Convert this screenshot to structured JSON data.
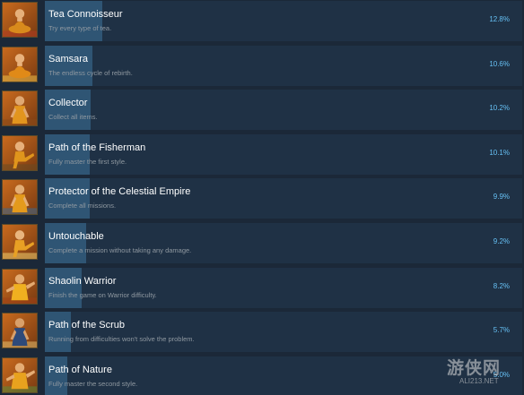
{
  "achievements": [
    {
      "title": "Tea Connoisseur",
      "description": "Try every type of tea.",
      "percent_label": "12.8%",
      "percent": 12.8,
      "icon": "tea-monk-icon"
    },
    {
      "title": "Samsara",
      "description": "The endless cycle of rebirth.",
      "percent_label": "10.6%",
      "percent": 10.6,
      "icon": "meditating-monk-icon"
    },
    {
      "title": "Collector",
      "description": "Collect all items.",
      "percent_label": "10.2%",
      "percent": 10.2,
      "icon": "collector-monk-icon"
    },
    {
      "title": "Path of the Fisherman",
      "description": "Fully master the first style.",
      "percent_label": "10.1%",
      "percent": 10.1,
      "icon": "fisherman-monk-icon"
    },
    {
      "title": "Protector of the Celestial Empire",
      "description": "Complete all missions.",
      "percent_label": "9.9%",
      "percent": 9.9,
      "icon": "protector-monk-icon"
    },
    {
      "title": "Untouchable",
      "description": "Complete a mission without taking any damage.",
      "percent_label": "9.2%",
      "percent": 9.2,
      "icon": "untouchable-monk-icon"
    },
    {
      "title": "Shaolin Warrior",
      "description": "Finish the game on Warrior difficulty.",
      "percent_label": "8.2%",
      "percent": 8.2,
      "icon": "shaolin-warrior-icon"
    },
    {
      "title": "Path of the Scrub",
      "description": "Running from difficulties won't solve the problem.",
      "percent_label": "5.7%",
      "percent": 5.7,
      "icon": "scrub-monk-icon"
    },
    {
      "title": "Path of Nature",
      "description": "Fully master the second style.",
      "percent_label": "5.0%",
      "percent": 5.0,
      "icon": "nature-monk-icon"
    }
  ],
  "watermark": {
    "main": "游侠网",
    "sub": "ALI213.NET"
  },
  "colors": {
    "background": "#1b2838",
    "panel": "#1f3145",
    "progress_fill": "#2f5574",
    "title_text": "#ffffff",
    "description_text": "#8f98a0",
    "percent_text": "#66c0f4"
  }
}
